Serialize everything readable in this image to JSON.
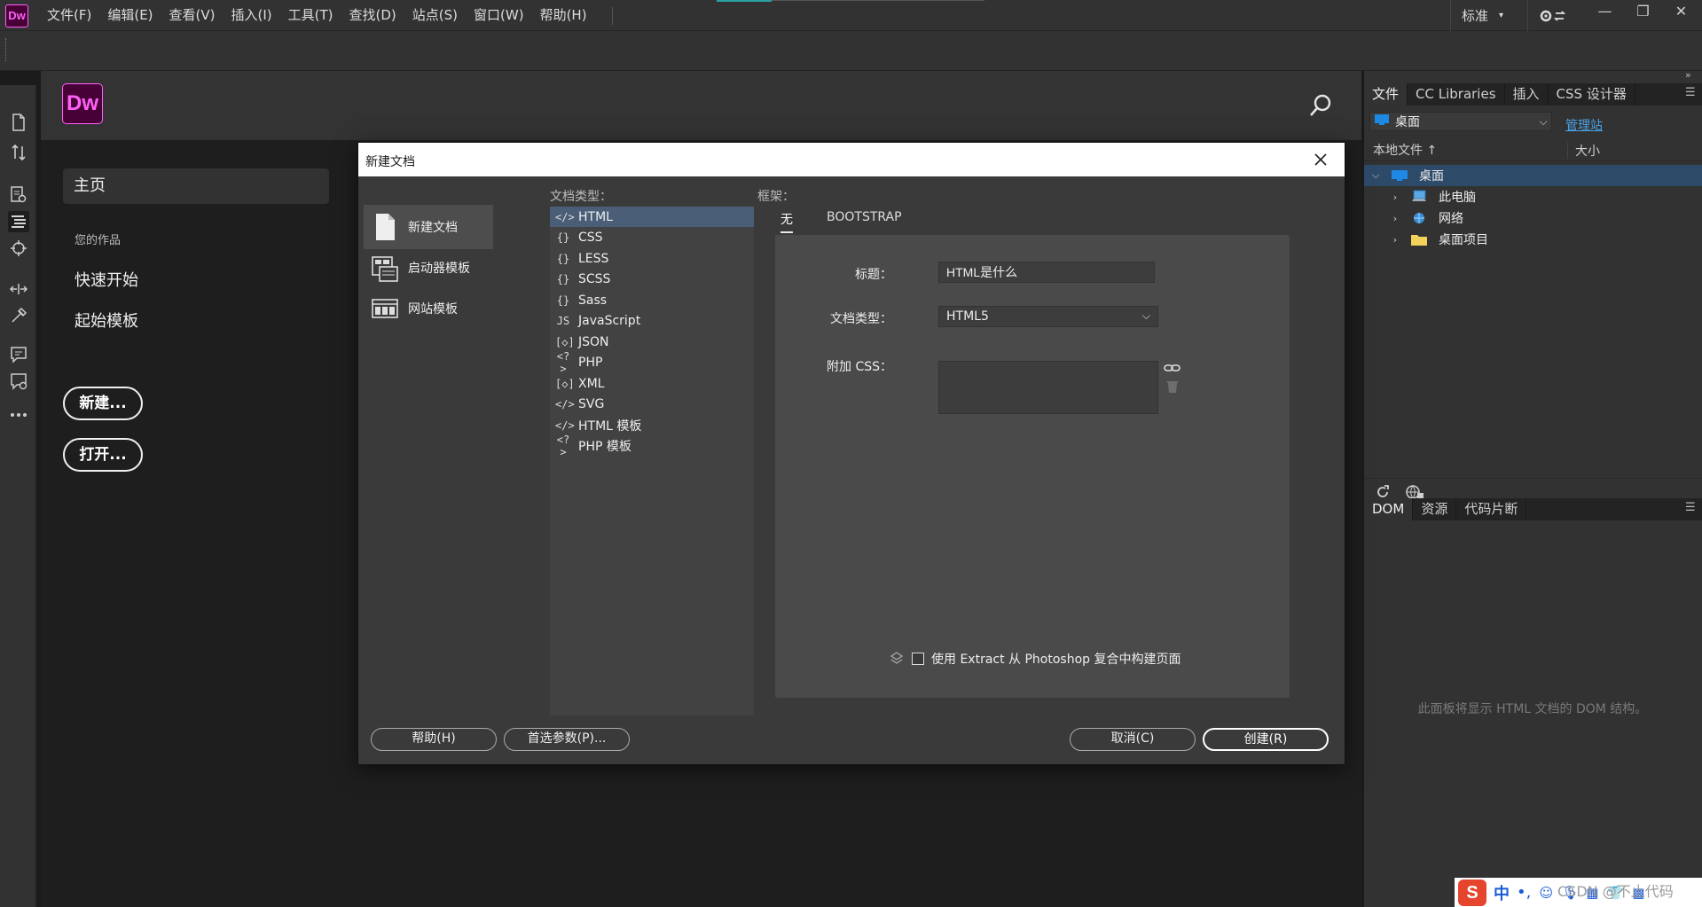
{
  "menubar": {
    "logo": "Dw",
    "items": [
      "文件(F)",
      "编辑(E)",
      "查看(V)",
      "插入(I)",
      "工具(T)",
      "查找(D)",
      "站点(S)",
      "窗口(W)",
      "帮助(H)"
    ],
    "workspace": "标准",
    "window_buttons": [
      "—",
      "❐",
      "✕"
    ]
  },
  "start": {
    "logo": "Dw",
    "home": "主页",
    "your_work": "您的作品",
    "quick_start": "快速开始",
    "starter_templates": "起始模板",
    "new_button": "新建...",
    "open_button": "打开..."
  },
  "files_panel": {
    "tabs": [
      "文件",
      "CC Libraries",
      "插入",
      "CSS 设计器"
    ],
    "site": "桌面",
    "manage_sites": "管理站",
    "col_local": "本地文件",
    "col_size": "大小",
    "tree": [
      {
        "label": "桌面",
        "level": 0,
        "expanded": true
      },
      {
        "label": "此电脑",
        "level": 1,
        "expanded": false
      },
      {
        "label": "网络",
        "level": 1,
        "expanded": false
      },
      {
        "label": "桌面项目",
        "level": 1,
        "expanded": false
      }
    ]
  },
  "dom_panel": {
    "tabs": [
      "DOM",
      "资源",
      "代码片断"
    ],
    "hint": "此面板将显示 HTML 文档的 DOM 结构。"
  },
  "dialog": {
    "title": "新建文档",
    "categories": [
      "新建文档",
      "启动器模板",
      "网站模板"
    ],
    "doctype_label": "文档类型：",
    "doctypes": [
      {
        "icon": "</>",
        "label": "HTML"
      },
      {
        "icon": "{}",
        "label": "CSS"
      },
      {
        "icon": "{}",
        "label": "LESS"
      },
      {
        "icon": "{}",
        "label": "SCSS"
      },
      {
        "icon": "{}",
        "label": "Sass"
      },
      {
        "icon": "JS",
        "label": "JavaScript"
      },
      {
        "icon": "[◇]",
        "label": "JSON"
      },
      {
        "icon": "<?>",
        "label": "PHP"
      },
      {
        "icon": "[◇]",
        "label": "XML"
      },
      {
        "icon": "</>",
        "label": "SVG"
      },
      {
        "icon": "</>",
        "label": "HTML 模板"
      },
      {
        "icon": "<?>",
        "label": "PHP 模板"
      }
    ],
    "framework_label": "框架：",
    "framework_tabs": [
      "无",
      "BOOTSTRAP"
    ],
    "title_label": "标题：",
    "title_value": "HTML是什么",
    "doctype_field_label": "文档类型：",
    "doctype_value": "HTML5",
    "attach_css_label": "附加 CSS：",
    "extract_text": "使用 Extract 从 Photoshop 复合中构建页面",
    "help_button": "帮助(H)",
    "prefs_button": "首选参数(P)...",
    "cancel_button": "取消(C)",
    "create_button": "创建(R)"
  },
  "tray": {
    "ime_logo": "S",
    "ime_lang": "中",
    "ime_punct": "•,",
    "watermark": "CSDN @不止代码"
  },
  "colors": {
    "accent": "#ff61f6",
    "logo_bg": "#470137",
    "selection": "#4a5e78",
    "link": "#4aa3e6"
  }
}
